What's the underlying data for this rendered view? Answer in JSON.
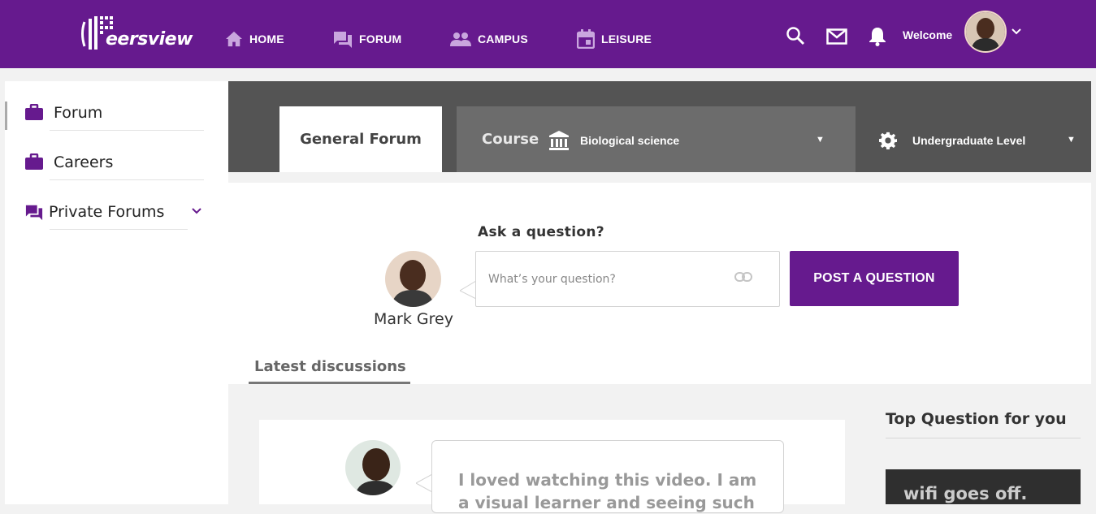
{
  "brand": {
    "logo_text": "eersview",
    "color": "#661a8e"
  },
  "nav": {
    "items": [
      {
        "label": "HOME",
        "icon": "home-icon"
      },
      {
        "label": "FORUM",
        "icon": "forum-icon"
      },
      {
        "label": "CAMPUS",
        "icon": "campus-icon"
      },
      {
        "label": "LEISURE",
        "icon": "calendar-icon"
      }
    ],
    "welcome": "Welcome"
  },
  "sidebar": {
    "items": [
      {
        "label": "Forum",
        "icon": "briefcase-icon",
        "active": true
      },
      {
        "label": "Careers",
        "icon": "briefcase-icon"
      },
      {
        "label": "Private Forums",
        "icon": "forum-icon",
        "expandable": true
      }
    ]
  },
  "header": {
    "tab_general": "General Forum",
    "course_label": "Course",
    "course_value": "Biological science",
    "level_value": "Undergraduate Level"
  },
  "ask": {
    "title": "Ask a question?",
    "user_name": "Mark Grey",
    "placeholder": "What’s your question?",
    "button": "POST A QUESTION"
  },
  "discussions": {
    "tab_label": "Latest discussions",
    "items": [
      {
        "text": "I loved watching this video. I am a visual learner and seeing such"
      }
    ]
  },
  "top_questions": {
    "title": "Top Question for you",
    "video_caption": "wifi goes off."
  }
}
